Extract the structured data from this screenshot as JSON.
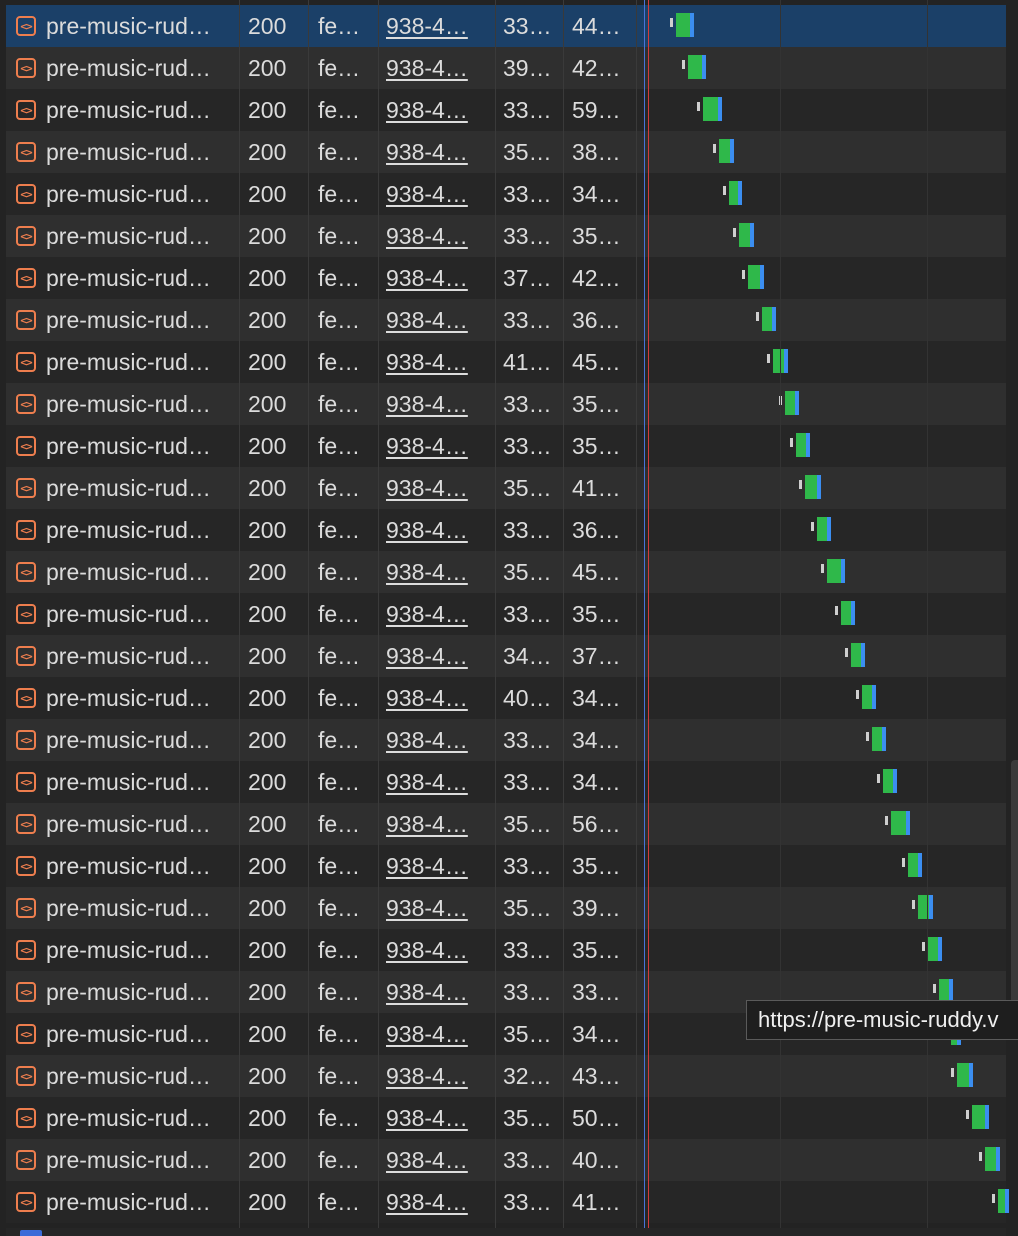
{
  "colors": {
    "selected_row": "#1b4068",
    "waiting_bar": "#cfcfcf",
    "receiving_bar": "#2fb84a",
    "download_bar": "#3b8ef0",
    "load_marker": "#d33b3b",
    "dom_marker": "#4a73d8",
    "doc_icon": "#ee7e4e"
  },
  "row_icon": "html-document-icon",
  "requests": [
    {
      "name": "pre-music-rud…",
      "status": "200",
      "type": "fe…",
      "initiator": "938-4…",
      "size": "33…",
      "time": "44…",
      "selected": true
    },
    {
      "name": "pre-music-rud…",
      "status": "200",
      "type": "fe…",
      "initiator": "938-4…",
      "size": "39…",
      "time": "42…"
    },
    {
      "name": "pre-music-rud…",
      "status": "200",
      "type": "fe…",
      "initiator": "938-4…",
      "size": "33…",
      "time": "59…"
    },
    {
      "name": "pre-music-rud…",
      "status": "200",
      "type": "fe…",
      "initiator": "938-4…",
      "size": "35…",
      "time": "38…"
    },
    {
      "name": "pre-music-rud…",
      "status": "200",
      "type": "fe…",
      "initiator": "938-4…",
      "size": "33…",
      "time": "34…"
    },
    {
      "name": "pre-music-rud…",
      "status": "200",
      "type": "fe…",
      "initiator": "938-4…",
      "size": "33…",
      "time": "35…"
    },
    {
      "name": "pre-music-rud…",
      "status": "200",
      "type": "fe…",
      "initiator": "938-4…",
      "size": "37…",
      "time": "42…"
    },
    {
      "name": "pre-music-rud…",
      "status": "200",
      "type": "fe…",
      "initiator": "938-4…",
      "size": "33…",
      "time": "36…"
    },
    {
      "name": "pre-music-rud…",
      "status": "200",
      "type": "fe…",
      "initiator": "938-4…",
      "size": "41…",
      "time": "45…"
    },
    {
      "name": "pre-music-rud…",
      "status": "200",
      "type": "fe…",
      "initiator": "938-4…",
      "size": "33…",
      "time": "35…"
    },
    {
      "name": "pre-music-rud…",
      "status": "200",
      "type": "fe…",
      "initiator": "938-4…",
      "size": "33…",
      "time": "35…"
    },
    {
      "name": "pre-music-rud…",
      "status": "200",
      "type": "fe…",
      "initiator": "938-4…",
      "size": "35…",
      "time": "41…"
    },
    {
      "name": "pre-music-rud…",
      "status": "200",
      "type": "fe…",
      "initiator": "938-4…",
      "size": "33…",
      "time": "36…"
    },
    {
      "name": "pre-music-rud…",
      "status": "200",
      "type": "fe…",
      "initiator": "938-4…",
      "size": "35…",
      "time": "45…"
    },
    {
      "name": "pre-music-rud…",
      "status": "200",
      "type": "fe…",
      "initiator": "938-4…",
      "size": "33…",
      "time": "35…"
    },
    {
      "name": "pre-music-rud…",
      "status": "200",
      "type": "fe…",
      "initiator": "938-4…",
      "size": "34…",
      "time": "37…"
    },
    {
      "name": "pre-music-rud…",
      "status": "200",
      "type": "fe…",
      "initiator": "938-4…",
      "size": "40…",
      "time": "34…"
    },
    {
      "name": "pre-music-rud…",
      "status": "200",
      "type": "fe…",
      "initiator": "938-4…",
      "size": "33…",
      "time": "34…"
    },
    {
      "name": "pre-music-rud…",
      "status": "200",
      "type": "fe…",
      "initiator": "938-4…",
      "size": "33…",
      "time": "34…"
    },
    {
      "name": "pre-music-rud…",
      "status": "200",
      "type": "fe…",
      "initiator": "938-4…",
      "size": "35…",
      "time": "56…"
    },
    {
      "name": "pre-music-rud…",
      "status": "200",
      "type": "fe…",
      "initiator": "938-4…",
      "size": "33…",
      "time": "35…"
    },
    {
      "name": "pre-music-rud…",
      "status": "200",
      "type": "fe…",
      "initiator": "938-4…",
      "size": "35…",
      "time": "39…"
    },
    {
      "name": "pre-music-rud…",
      "status": "200",
      "type": "fe…",
      "initiator": "938-4…",
      "size": "33…",
      "time": "35…"
    },
    {
      "name": "pre-music-rud…",
      "status": "200",
      "type": "fe…",
      "initiator": "938-4…",
      "size": "33…",
      "time": "33…"
    },
    {
      "name": "pre-music-rud…",
      "status": "200",
      "type": "fe…",
      "initiator": "938-4…",
      "size": "35…",
      "time": "34…"
    },
    {
      "name": "pre-music-rud…",
      "status": "200",
      "type": "fe…",
      "initiator": "938-4…",
      "size": "32…",
      "time": "43…"
    },
    {
      "name": "pre-music-rud…",
      "status": "200",
      "type": "fe…",
      "initiator": "938-4…",
      "size": "35…",
      "time": "50…"
    },
    {
      "name": "pre-music-rud…",
      "status": "200",
      "type": "fe…",
      "initiator": "938-4…",
      "size": "33…",
      "time": "40…"
    },
    {
      "name": "pre-music-rud…",
      "status": "200",
      "type": "fe…",
      "initiator": "938-4…",
      "size": "33…",
      "time": "41…"
    }
  ],
  "tooltip": {
    "text": "https://pre-music-ruddy.v"
  }
}
